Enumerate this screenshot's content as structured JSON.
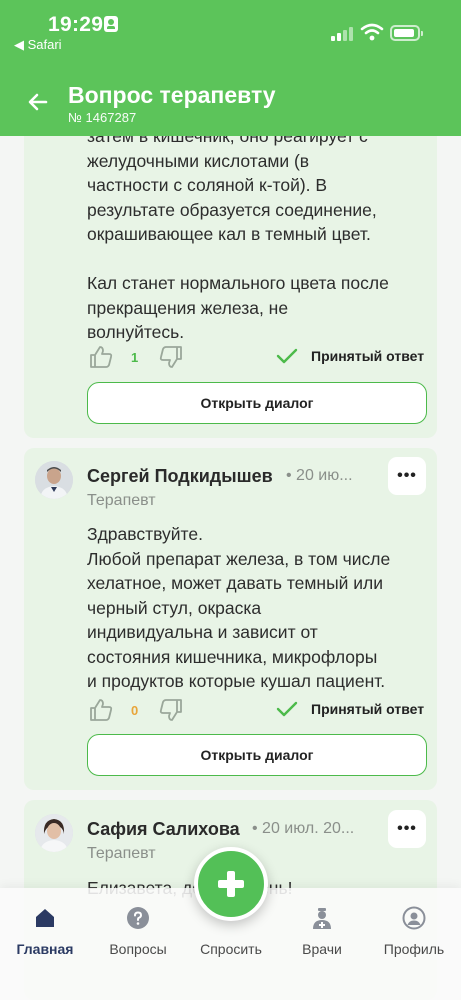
{
  "status_bar": {
    "time": "19:29",
    "back_app": "◀ Safari"
  },
  "header": {
    "title": "Вопрос терапевту",
    "question_number": "№ 1467287"
  },
  "answers": [
    {
      "text": "затем в кишечник, оно реагирует с\nжелудочными кислотами (в\nчастности с соляной к-той). В\nрезультате образуется соединение,\nокрашивающее кал в темный цвет.\n\nКал станет нормального цвета после\nпрекращения железа, не\nволнуйтесь.",
      "likes": "1",
      "accepted_label": "Принятый ответ",
      "dialog_button": "Открыть диалог"
    },
    {
      "author": "Сергей Подкидышев",
      "date": "• 20 ию...",
      "role": "Терапевт",
      "more": "•••",
      "text": "Здравствуйте.\nЛюбой препарат железа, в том числе\nхелатное, может давать темный или\nчерный стул, окраска\nиндивидуальна и зависит от\nсостояния кишечника, микрофлоры\nи продуктов которые кушал пациент.",
      "likes": "0",
      "accepted_label": "Принятый ответ",
      "dialog_button": "Открыть диалог"
    },
    {
      "author": "Сафия Салихова",
      "date": "• 20 июл. 20...",
      "role": "Терапевт",
      "more": "•••",
      "text": "Елизавета, добрый день!"
    }
  ],
  "bottom_nav": {
    "items": [
      {
        "label": "Главная",
        "icon": "home-icon",
        "active": true
      },
      {
        "label": "Вопросы",
        "icon": "question-icon"
      },
      {
        "label": "Спросить",
        "icon": "plus-icon"
      },
      {
        "label": "Врачи",
        "icon": "doctor-icon"
      },
      {
        "label": "Профиль",
        "icon": "profile-icon"
      }
    ]
  },
  "colors": {
    "brand_green": "#5cc45a",
    "card_bg": "#e8f4e6",
    "accent_green": "#4cba4a",
    "active_nav": "#2b3a63",
    "orange_count": "#e8a53a"
  }
}
